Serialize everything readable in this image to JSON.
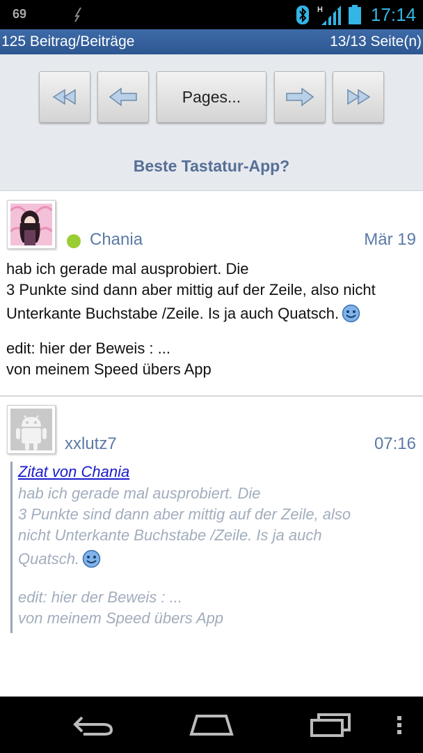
{
  "status_bar": {
    "notification_count": "69",
    "time": "17:14",
    "network_label": "H",
    "icons": [
      "notification-icon",
      "bluetooth-icon",
      "signal-icon",
      "battery-icon"
    ]
  },
  "header": {
    "post_count": "125 Beitrag/Beiträge",
    "page_info": "13/13 Seite(n)"
  },
  "toolbar": {
    "pages_label": "Pages...",
    "thread_title": "Beste Tastatur-App?"
  },
  "posts": [
    {
      "username": "Chania",
      "date": "Mär 19",
      "online": true,
      "body": {
        "line1": "hab ich gerade mal ausprobiert. Die",
        "line2": "3 Punkte sind dann aber mittig auf der Zeile, also nicht",
        "line3": "Unterkante Buchstabe /Zeile. Is ja auch Quatsch.",
        "line4": "edit: hier der Beweis : ...",
        "line5": "von meinem Speed übers App"
      }
    },
    {
      "username": "xxlutz7",
      "date": "07:16",
      "quote": {
        "link": "Zitat von Chania",
        "line1": "hab ich gerade mal ausprobiert. Die",
        "line2": "3 Punkte sind dann aber mittig auf der Zeile, also",
        "line3": "nicht Unterkante Buchstabe /Zeile. Is ja auch",
        "line4": "Quatsch.",
        "line5": "edit: hier der Beweis : ...",
        "line6": "von meinem Speed übers App"
      }
    }
  ],
  "colors": {
    "header_bg": "#2d5791",
    "accent_blue": "#33b5e5",
    "username": "#5b7aa6",
    "online": "#9acd32",
    "quote_text": "#a2adbd",
    "link": "#1a1acc"
  }
}
